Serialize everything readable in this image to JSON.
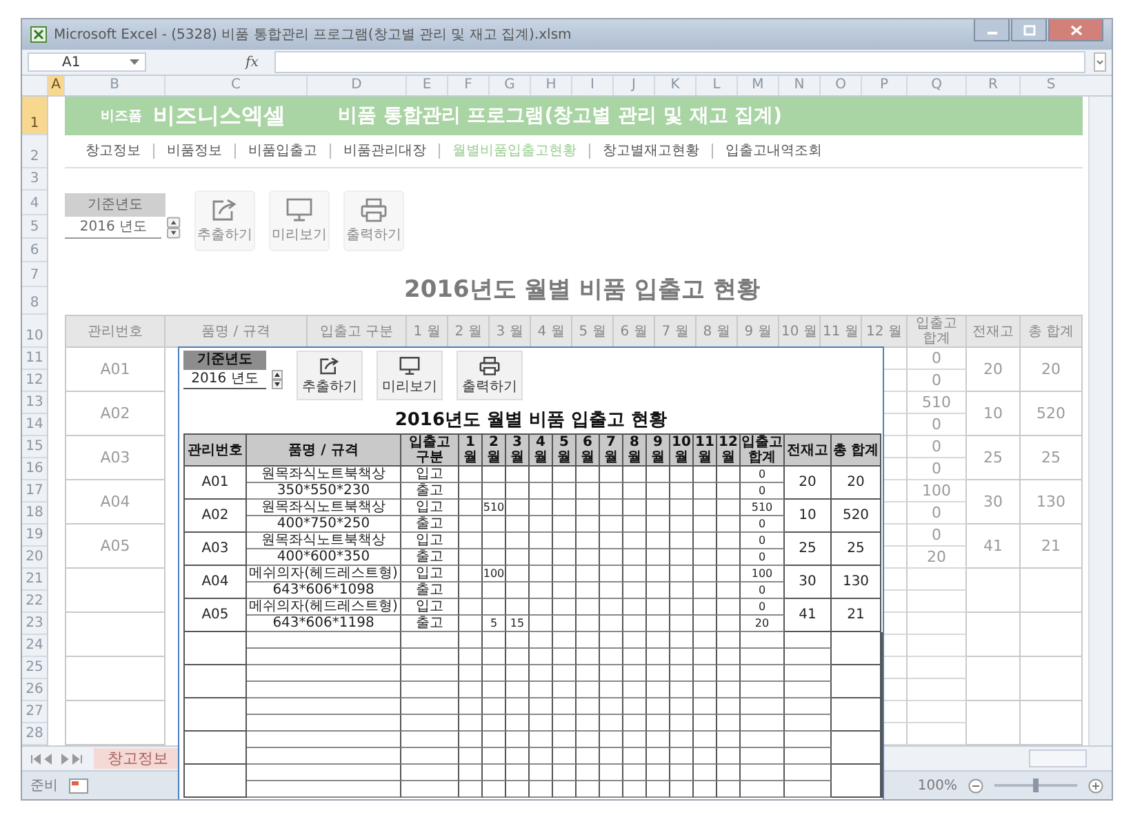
{
  "window": {
    "title": "Microsoft Excel - (5328) 비품 통합관리 프로그램(창고별 관리 및 재고 집계).xlsm"
  },
  "formula_bar": {
    "name_box": "A1",
    "fx": "fx"
  },
  "column_headers": [
    {
      "label": "A",
      "selected": true
    },
    {
      "label": "B",
      "selected": false
    },
    {
      "label": "C",
      "selected": false
    },
    {
      "label": "D",
      "selected": false
    },
    {
      "label": "E",
      "selected": false
    },
    {
      "label": "F",
      "selected": false
    },
    {
      "label": "G",
      "selected": false
    },
    {
      "label": "H",
      "selected": false
    },
    {
      "label": "I",
      "selected": false
    },
    {
      "label": "J",
      "selected": false
    },
    {
      "label": "K",
      "selected": false
    },
    {
      "label": "L",
      "selected": false
    },
    {
      "label": "M",
      "selected": false
    },
    {
      "label": "N",
      "selected": false
    },
    {
      "label": "O",
      "selected": false
    },
    {
      "label": "P",
      "selected": false
    },
    {
      "label": "Q",
      "selected": false
    },
    {
      "label": "R",
      "selected": false
    },
    {
      "label": "S",
      "selected": false
    }
  ],
  "row_numbers": [
    {
      "label": "1",
      "selected": true
    },
    {
      "label": "2",
      "selected": false
    },
    {
      "label": "3",
      "selected": false
    },
    {
      "label": "4",
      "selected": false
    },
    {
      "label": "5",
      "selected": false
    },
    {
      "label": "6",
      "selected": false
    },
    {
      "label": "7",
      "selected": false
    },
    {
      "label": "8",
      "selected": false
    },
    {
      "label": "10",
      "selected": false
    },
    {
      "label": "11",
      "selected": false
    },
    {
      "label": "12",
      "selected": false
    },
    {
      "label": "13",
      "selected": false
    },
    {
      "label": "14",
      "selected": false
    },
    {
      "label": "15",
      "selected": false
    },
    {
      "label": "16",
      "selected": false
    },
    {
      "label": "17",
      "selected": false
    },
    {
      "label": "18",
      "selected": false
    },
    {
      "label": "19",
      "selected": false
    },
    {
      "label": "20",
      "selected": false
    },
    {
      "label": "21",
      "selected": false
    },
    {
      "label": "22",
      "selected": false
    },
    {
      "label": "23",
      "selected": false
    },
    {
      "label": "24",
      "selected": false
    },
    {
      "label": "25",
      "selected": false
    },
    {
      "label": "26",
      "selected": false
    },
    {
      "label": "27",
      "selected": false
    },
    {
      "label": "28",
      "selected": false
    }
  ],
  "banner": {
    "brand_small": "비즈폼",
    "brand": "비즈니스엑셀",
    "title": "비품 통합관리 프로그램(창고별 관리 및 재고 집계)"
  },
  "nav": [
    {
      "label": "창고정보",
      "selected": false
    },
    {
      "label": "비품정보",
      "selected": false
    },
    {
      "label": "비품입출고",
      "selected": false
    },
    {
      "label": "비품관리대장",
      "selected": false
    },
    {
      "label": "월별비품입출고현황",
      "selected": true
    },
    {
      "label": "창고별재고현황",
      "selected": false
    },
    {
      "label": "입출고내역조회",
      "selected": false
    }
  ],
  "year_control": {
    "label": "기준년도",
    "value": "2016 년도"
  },
  "actions": [
    {
      "kind": "export",
      "label": "추출하기"
    },
    {
      "kind": "preview",
      "label": "미리보기"
    },
    {
      "kind": "print",
      "label": "출력하기"
    }
  ],
  "report_title": "2016년도 월별 비품 입출고 현황",
  "table": {
    "columns": [
      "관리번호",
      "품명 / 규격",
      "입출고 구분",
      "1 월",
      "2 월",
      "3 월",
      "4 월",
      "5 월",
      "6 월",
      "7 월",
      "8 월",
      "9 월",
      "10 월",
      "11 월",
      "12 월",
      "입출고 합계",
      "전재고",
      "총 합계"
    ],
    "rows": [
      {
        "id": "A01",
        "totals": [
          "0",
          "0"
        ],
        "stock": "20",
        "total": "20"
      },
      {
        "id": "A02",
        "totals": [
          "510",
          "0"
        ],
        "stock": "10",
        "total": "520"
      },
      {
        "id": "A03",
        "totals": [
          "0",
          "0"
        ],
        "stock": "25",
        "total": "25"
      },
      {
        "id": "A04",
        "totals": [
          "100",
          "0"
        ],
        "stock": "30",
        "total": "130"
      },
      {
        "id": "A05",
        "totals": [
          "0",
          "20"
        ],
        "stock": "41",
        "total": "21"
      }
    ]
  },
  "preview": {
    "year_control": {
      "label": "기준년도",
      "value": "2016 년도"
    },
    "actions": [
      {
        "kind": "export",
        "label": "추출하기"
      },
      {
        "kind": "preview",
        "label": "미리보기"
      },
      {
        "kind": "print",
        "label": "출력하기"
      }
    ],
    "title": "2016년도 월별 비품 입출고 현황",
    "columns": [
      "관리번호",
      "품명 / 규격",
      "입출고 구분",
      "1 월",
      "2 월",
      "3 월",
      "4 월",
      "5 월",
      "6 월",
      "7 월",
      "8 월",
      "9 월",
      "10 월",
      "11 월",
      "12 월",
      "입출고 합계",
      "전재고",
      "총 합계"
    ],
    "items": [
      {
        "id": "A01",
        "lines": [
          {
            "name": "원목좌식노트북책상",
            "type": "입고",
            "total": "0"
          },
          {
            "name": "350*550*230",
            "type": "출고",
            "total": "0"
          }
        ],
        "stock": "20",
        "total": "20"
      },
      {
        "id": "A02",
        "lines": [
          {
            "name": "원목좌식노트북책상",
            "type": "입고",
            "months": {
              "2": "510"
            },
            "total": "510"
          },
          {
            "name": "400*750*250",
            "type": "출고",
            "total": "0"
          }
        ],
        "stock": "10",
        "total": "520"
      },
      {
        "id": "A03",
        "lines": [
          {
            "name": "원목좌식노트북책상",
            "type": "입고",
            "total": "0"
          },
          {
            "name": "400*600*350",
            "type": "출고",
            "total": "0"
          }
        ],
        "stock": "25",
        "total": "25"
      },
      {
        "id": "A04",
        "lines": [
          {
            "name": "메쉬의자(헤드레스트형)",
            "type": "입고",
            "months": {
              "2": "100"
            },
            "total": "100"
          },
          {
            "name": "643*606*1098",
            "type": "출고",
            "total": "0"
          }
        ],
        "stock": "30",
        "total": "130"
      },
      {
        "id": "A05",
        "lines": [
          {
            "name": "메쉬의자(헤드레스트형)",
            "type": "입고",
            "total": "0"
          },
          {
            "name": "643*606*1198",
            "type": "출고",
            "months": {
              "2": "5",
              "3": "15"
            },
            "total": "20"
          }
        ],
        "stock": "41",
        "total": "21"
      }
    ]
  },
  "sheet_tabs": [
    {
      "label": "창고정보",
      "selected": true
    }
  ],
  "status_bar": {
    "text": "준비",
    "zoom": "100%",
    "level": 0.5
  }
}
